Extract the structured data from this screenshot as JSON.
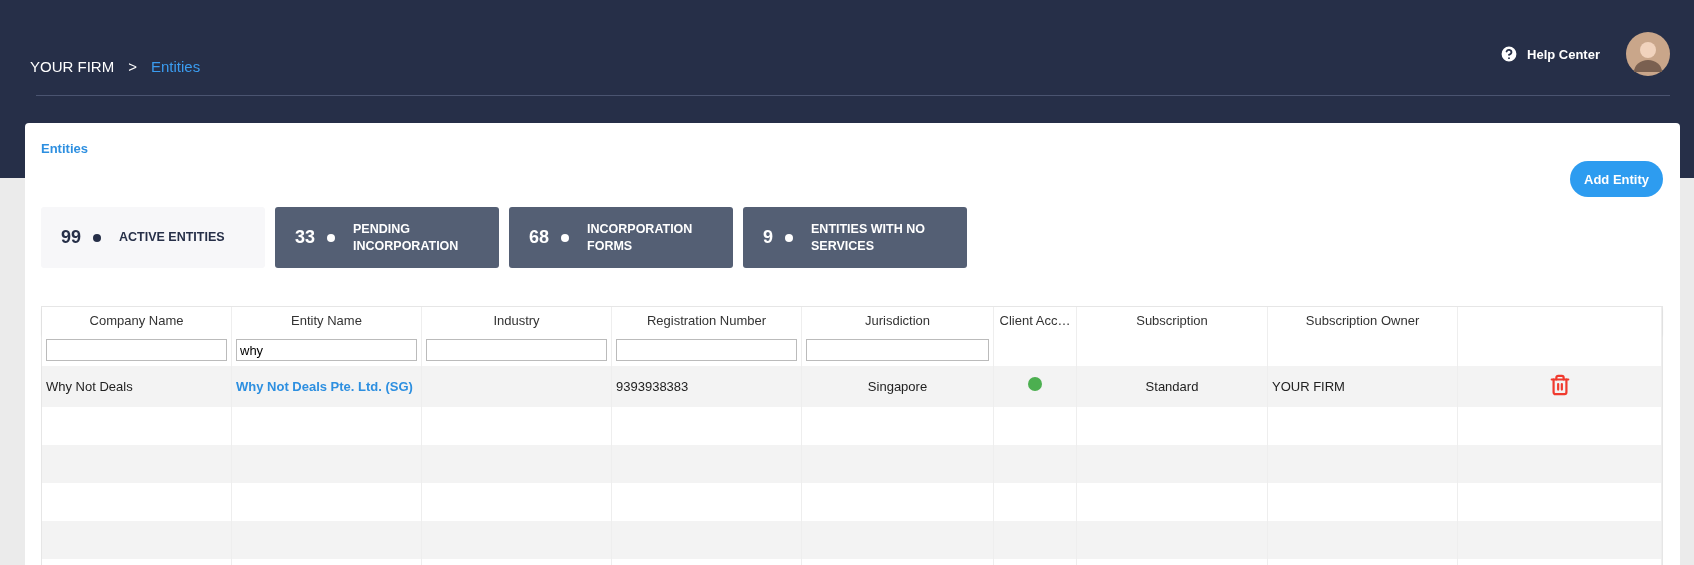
{
  "breadcrumb": [
    {
      "label": "YOUR FIRM",
      "selected": false
    },
    {
      "label": "Entities",
      "selected": true
    }
  ],
  "breadcrumb_separator": ">",
  "help_center": "Help Center",
  "page_title": "Entities",
  "add_button": "Add Entity",
  "stats": [
    {
      "count": "99",
      "label": "ACTIVE ENTITIES",
      "selected": true
    },
    {
      "count": "33",
      "label": "PENDING INCORPORATION",
      "selected": false
    },
    {
      "count": "68",
      "label": "INCORPORATION FORMS",
      "selected": false
    },
    {
      "count": "9",
      "label": "ENTITIES WITH NO SERVICES",
      "selected": false
    }
  ],
  "table": {
    "columns": [
      {
        "label": "Company Name",
        "filterable": true
      },
      {
        "label": "Entity Name",
        "filterable": true,
        "filter": "why"
      },
      {
        "label": "Industry",
        "filterable": true
      },
      {
        "label": "Registration Number",
        "filterable": true
      },
      {
        "label": "Jurisdiction",
        "filterable": true
      },
      {
        "label": "Client Acc…",
        "filterable": false
      },
      {
        "label": "Subscription",
        "filterable": false
      },
      {
        "label": "Subscription Owner",
        "filterable": false
      },
      {
        "filterable": false
      }
    ],
    "rows": [
      {
        "company_name": "Why Not Deals",
        "entity_name": "Why Not Deals Pte. Ltd. (SG)",
        "registration_number": "9393938383",
        "jurisdiction": "Singapore",
        "client_access": true,
        "subscription": "Standard",
        "subscription_owner": "YOUR FIRM"
      }
    ]
  }
}
